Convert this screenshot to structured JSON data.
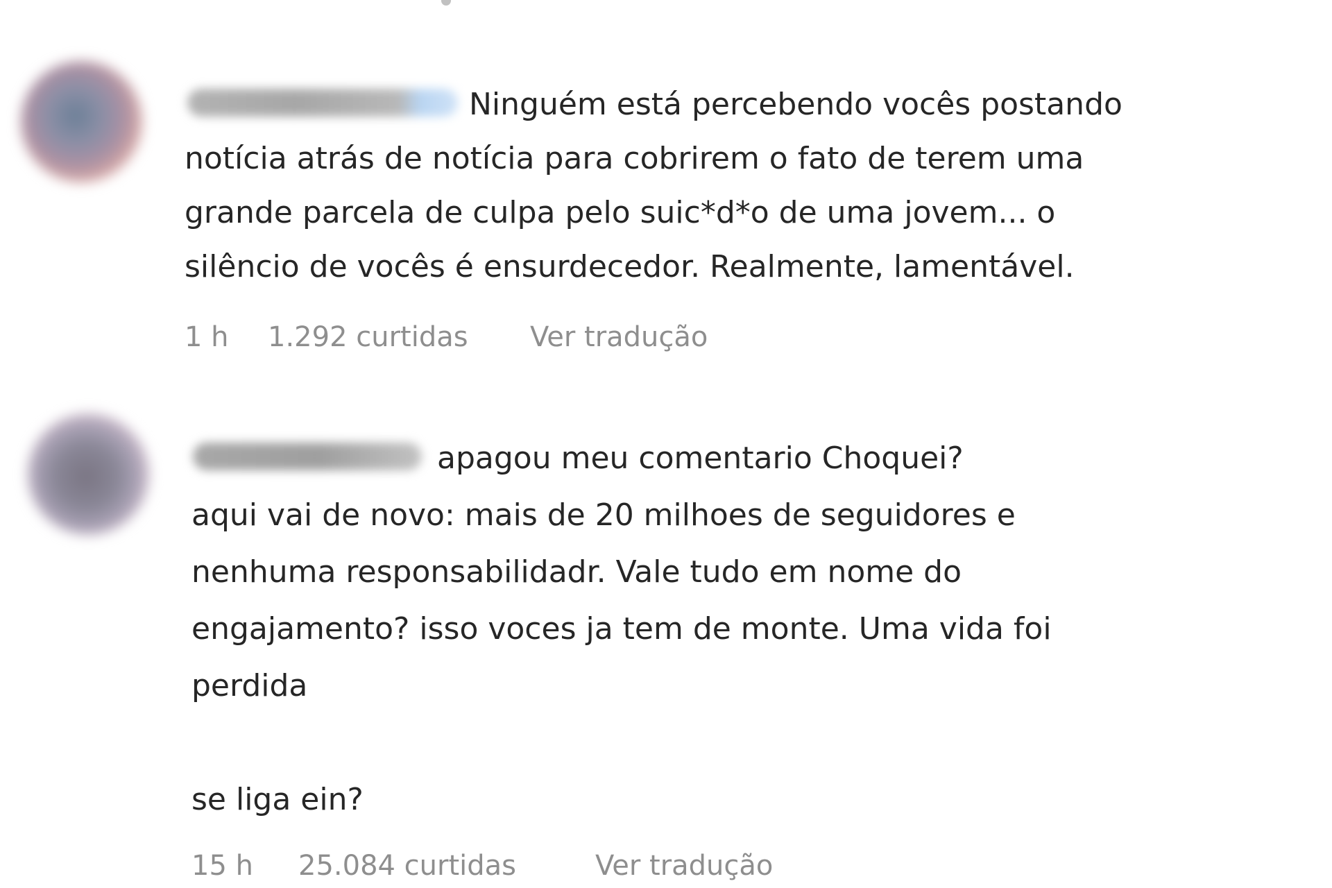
{
  "comments": [
    {
      "text_lines": [
        "Ninguém está percebendo vocês postando",
        "notícia atrás de notícia para cobrirem o fato de terem uma",
        "grande parcela de culpa pelo suic*d*o de uma jovem... o",
        "silêncio de vocês é ensurdecedor. Realmente, lamentável."
      ],
      "time": "1 h",
      "likes": "1.292 curtidas",
      "translate_label": "Ver tradução"
    },
    {
      "text_lines": [
        "apagou meu comentario Choquei?",
        "aqui vai de novo: mais de 20 milhoes de seguidores e",
        "nenhuma responsabilidadr. Vale tudo em nome do",
        "engajamento? isso voces ja tem de monte. Uma vida foi",
        "perdida",
        "",
        "se liga ein?"
      ],
      "time": "15 h",
      "likes": "25.084 curtidas",
      "translate_label": "Ver tradução"
    }
  ]
}
